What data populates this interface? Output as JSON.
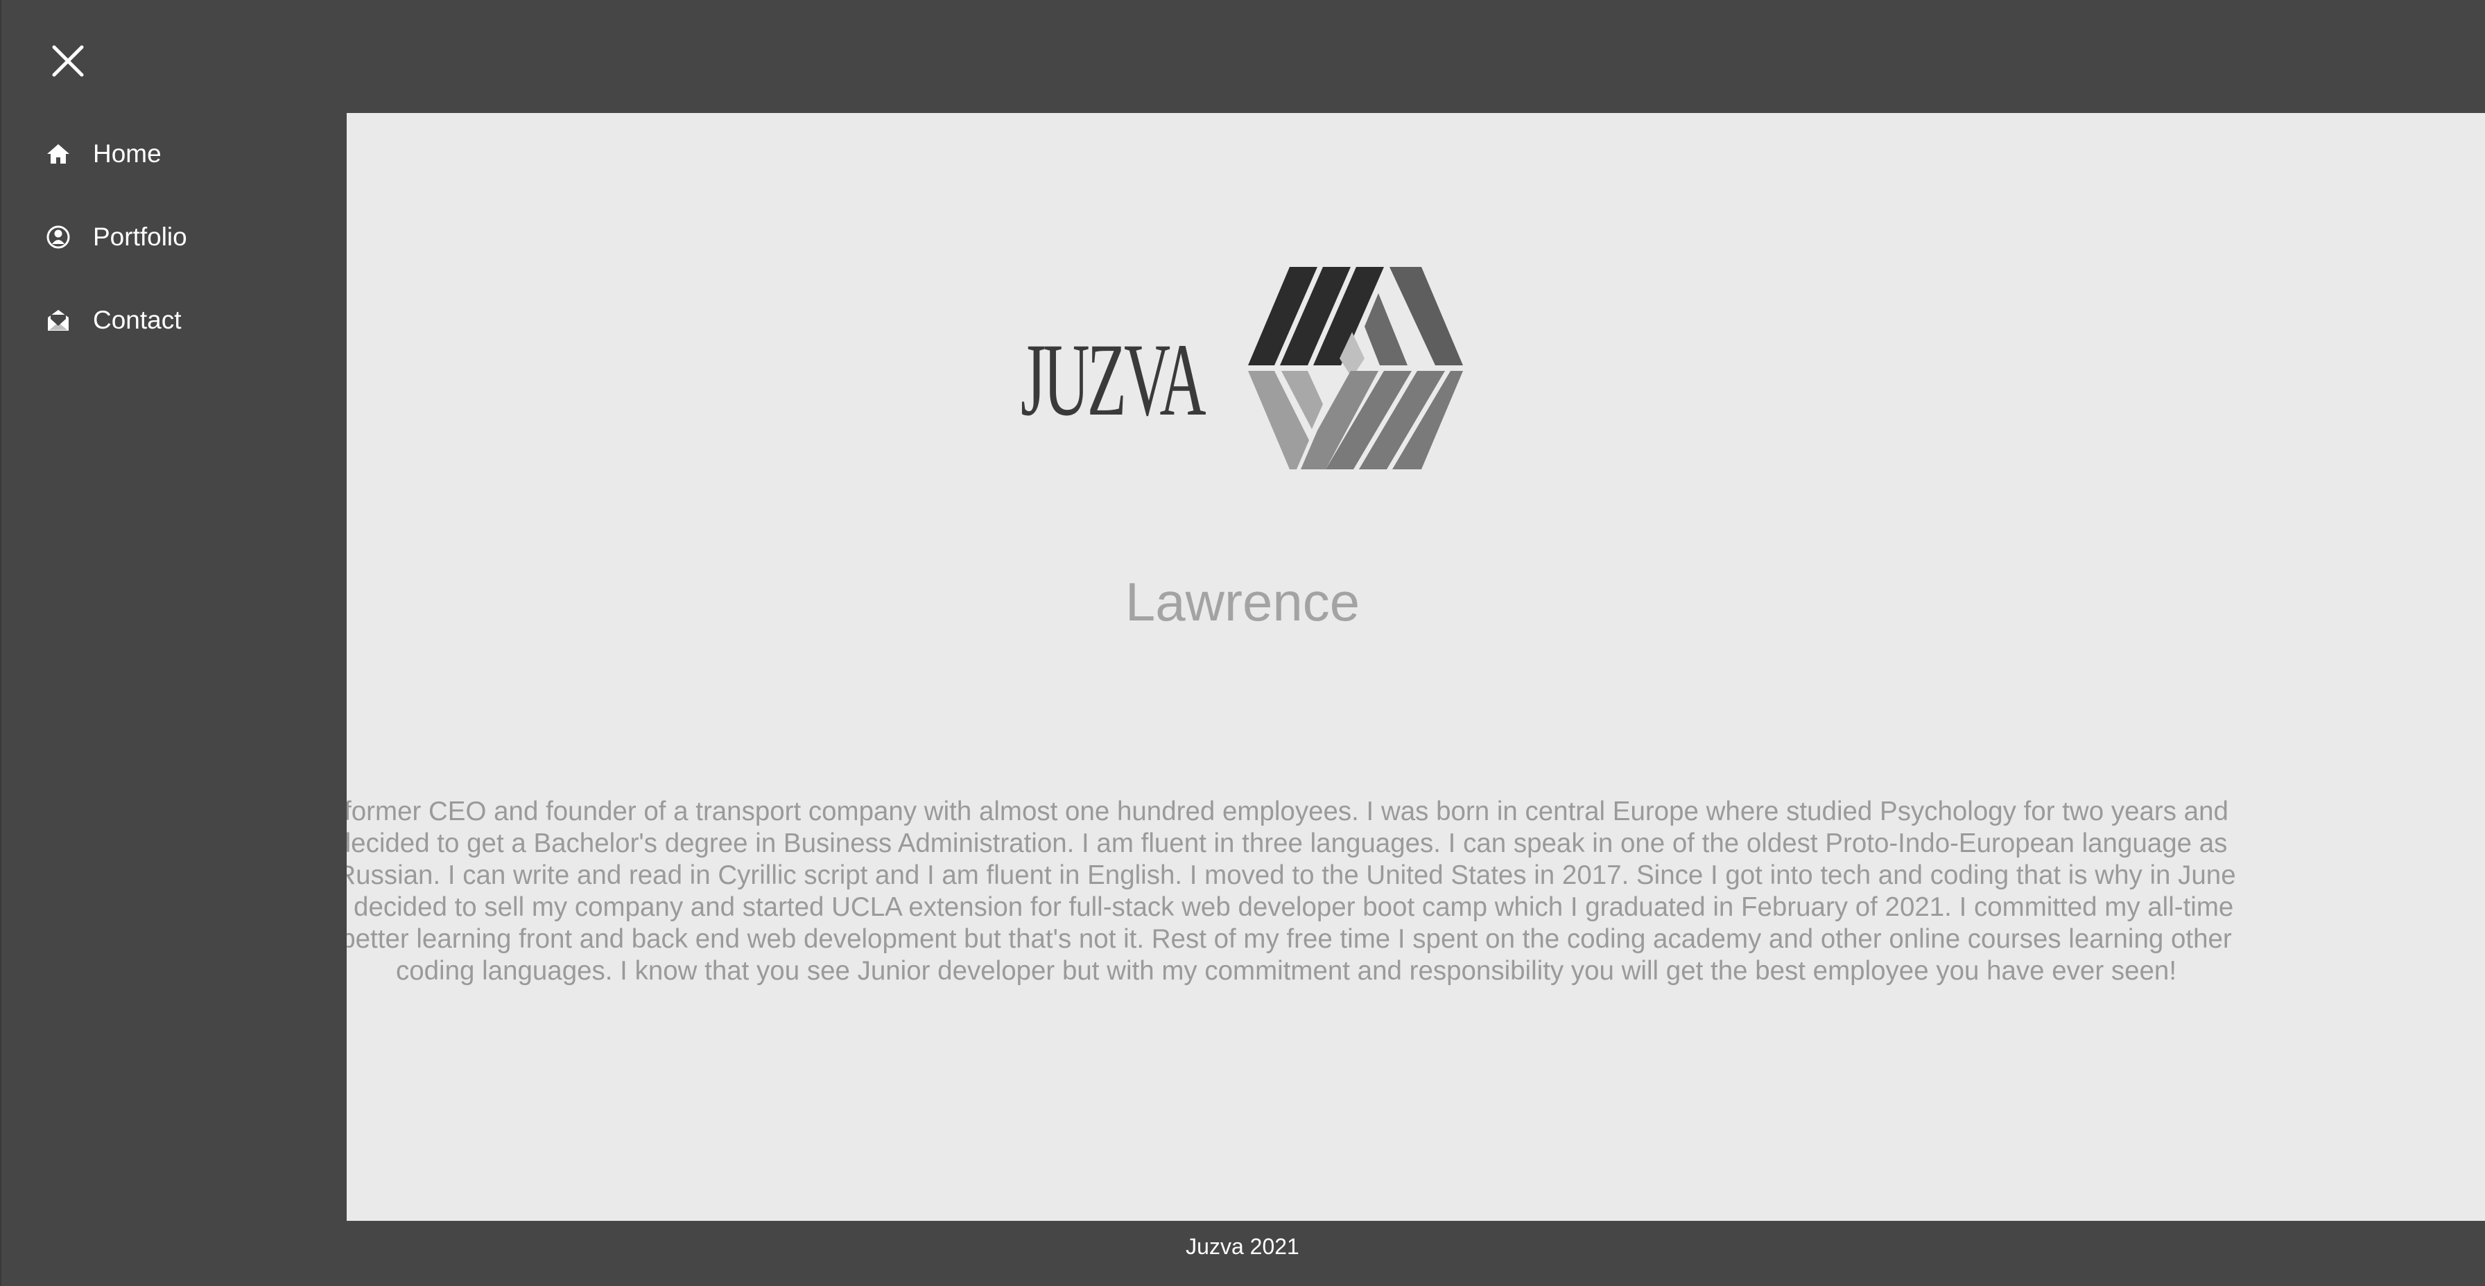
{
  "nav": {
    "close_icon": "close-icon",
    "items": [
      {
        "label": "Home",
        "icon": "home-icon"
      },
      {
        "label": "Portfolio",
        "icon": "user-circle-icon"
      },
      {
        "label": "Contact",
        "icon": "envelope-open-icon"
      }
    ]
  },
  "brand": {
    "name": "JUZVA",
    "mark": "juzva-hexagon-logo"
  },
  "hero": {
    "name": "Lawrence"
  },
  "bio": {
    "lines": [
      "former CEO and founder of a transport company with almost one hundred employees. I was born in central Europe where studied Psychology for two years and",
      "lecided to get a Bachelor's degree in Business Administration. I am fluent in three languages. I can speak in one of the oldest Proto-Indo-European language as",
      "Russian. I can write and read in Cyrillic script and I am fluent in English. I moved to the United States in 2017. Since I got into tech and coding that is why in June",
      "I decided to sell my company and started UCLA extension for full-stack web developer boot camp which I graduated in February of 2021. I committed my all-time",
      "better learning front and back end web development but that's not it. Rest of my free time I spent on the coding academy and other online courses learning other",
      "coding languages. I know that you see Junior developer but with my commitment and responsibility you will get the best employee you have ever seen!"
    ]
  },
  "footer": {
    "text": "Juzva 2021"
  },
  "colors": {
    "chrome": "#474647",
    "content_bg": "#eaeaea",
    "text_light": "#ffffff",
    "text_muted": "#9a9a9a"
  }
}
